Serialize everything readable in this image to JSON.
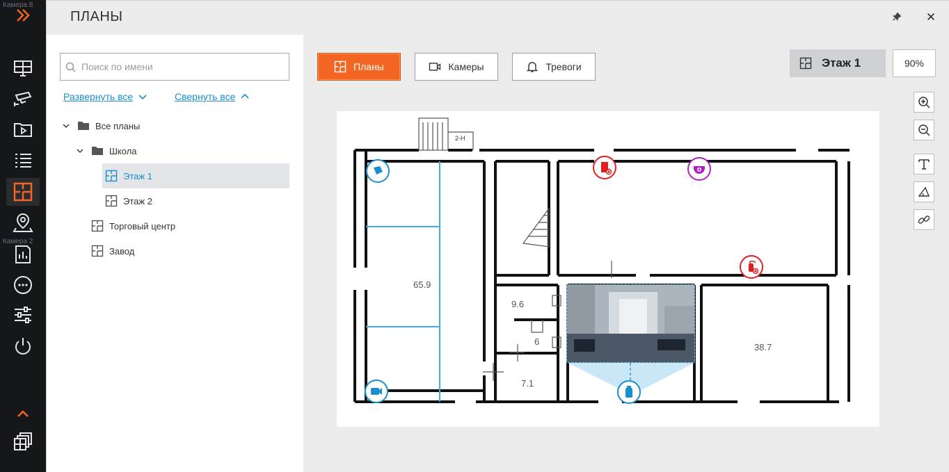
{
  "window": {
    "title": "ПЛАНЫ",
    "pin_icon": "pin-icon",
    "close_icon": "close-icon"
  },
  "sidebar": {
    "cam_labels": [
      "Камера 8",
      "Камера 2"
    ],
    "items": [
      {
        "name": "expand-panel",
        "icon": "double-chevron-right-icon"
      },
      {
        "name": "monitoring",
        "icon": "monitor-grid-icon"
      },
      {
        "name": "cameras",
        "icon": "cctv-camera-icon"
      },
      {
        "name": "archive",
        "icon": "video-play-icon"
      },
      {
        "name": "events",
        "icon": "list-icon"
      },
      {
        "name": "plans",
        "icon": "floor-plan-icon",
        "active": true
      },
      {
        "name": "map",
        "icon": "map-pin-icon"
      },
      {
        "name": "reports",
        "icon": "report-chart-icon"
      },
      {
        "name": "more",
        "icon": "more-dots-icon"
      },
      {
        "name": "settings",
        "icon": "sliders-icon"
      },
      {
        "name": "power",
        "icon": "power-icon"
      },
      {
        "name": "collapse-up",
        "icon": "chevron-up-icon"
      },
      {
        "name": "layouts",
        "icon": "layouts-icon"
      }
    ]
  },
  "tree": {
    "search_placeholder": "Поиск по имени",
    "expand_all": "Развернуть все",
    "collapse_all": "Свернуть все",
    "items": [
      {
        "label": "Все планы",
        "level": 0,
        "type": "folder",
        "expanded": true
      },
      {
        "label": "Школа",
        "level": 1,
        "type": "folder",
        "expanded": true
      },
      {
        "label": "Этаж 1",
        "level": 2,
        "type": "plan",
        "selected": true
      },
      {
        "label": "Этаж 2",
        "level": 2,
        "type": "plan"
      },
      {
        "label": "Торговый центр",
        "level": 1,
        "type": "plan"
      },
      {
        "label": "Завод",
        "level": 1,
        "type": "plan"
      }
    ]
  },
  "toolbar": {
    "tabs": [
      {
        "label": "Планы",
        "icon": "floor-plan-icon",
        "active": true
      },
      {
        "label": "Камеры",
        "icon": "camera-icon"
      },
      {
        "label": "Тревоги",
        "icon": "bell-icon"
      }
    ],
    "floor_label": "Этаж 1",
    "zoom": "90%"
  },
  "tools": [
    "zoom-in-icon",
    "zoom-out-icon",
    "text-icon",
    "angle-icon",
    "link-icon"
  ],
  "plan": {
    "rooms": [
      "65.9",
      "9.6",
      "6",
      "7.1",
      "38.7"
    ],
    "stair_label": "2-Н"
  },
  "colors": {
    "accent": "#f26522",
    "link": "#1a8fcf",
    "camera_marker": "#1a8fcf",
    "alarm_marker": "#e02020",
    "dome_marker": "#b020c0"
  }
}
